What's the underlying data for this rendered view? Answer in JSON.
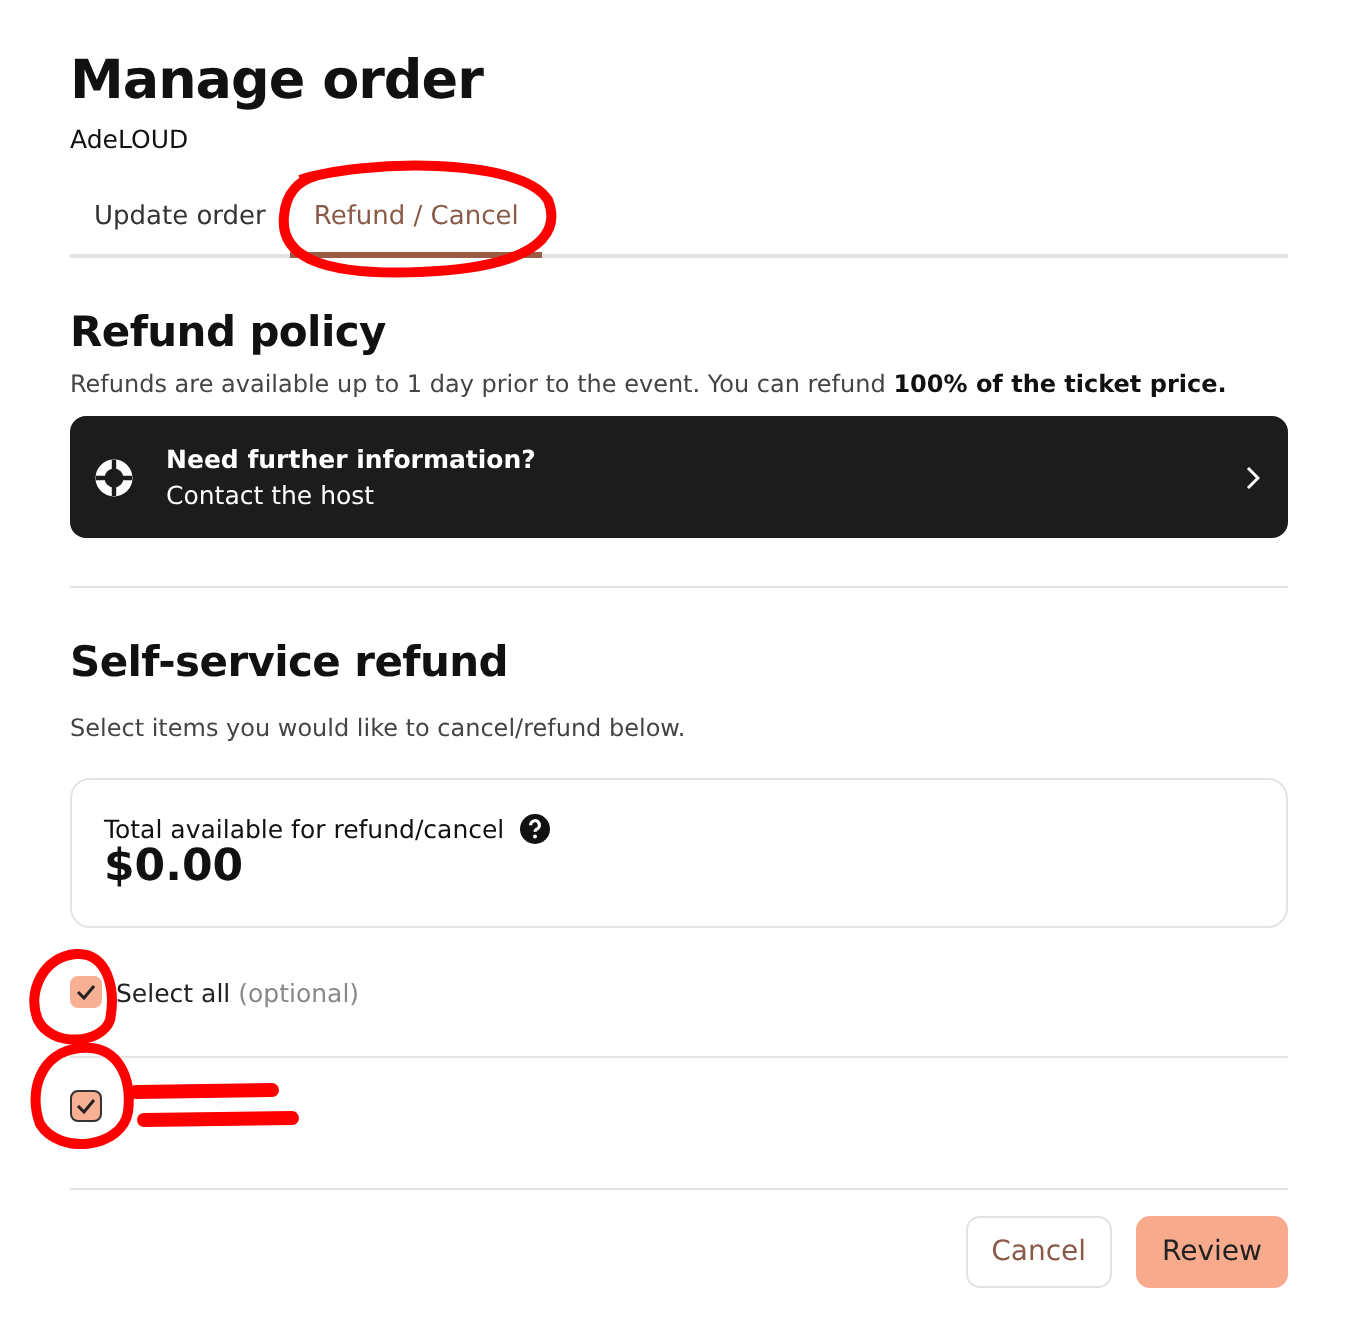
{
  "header": {
    "title": "Manage order",
    "subtitle": "AdeLOUD"
  },
  "tabs": [
    {
      "label": "Update order",
      "selected": false
    },
    {
      "label": "Refund / Cancel",
      "selected": true
    }
  ],
  "refund_policy": {
    "title": "Refund policy",
    "text": "Refunds are available up to 1 day prior to the event. You can refund **100% of the ticket price.**",
    "info_card": {
      "title": "Need further information?",
      "link": "Contact the host"
    }
  },
  "self_service": {
    "title": "Self-service refund",
    "description": "Select items you would like to cancel/refund below.",
    "total": {
      "label": "Total available for refund/cancel",
      "amount": "$0.00"
    },
    "select_all": {
      "label": "Select all",
      "hint": "(optional)",
      "checked": true
    },
    "items": [
      {
        "checked": true,
        "redacted": true
      }
    ]
  },
  "buttons": [
    {
      "label": "Cancel",
      "kind": "secondary"
    },
    {
      "label": "Review",
      "kind": "primary"
    }
  ]
}
